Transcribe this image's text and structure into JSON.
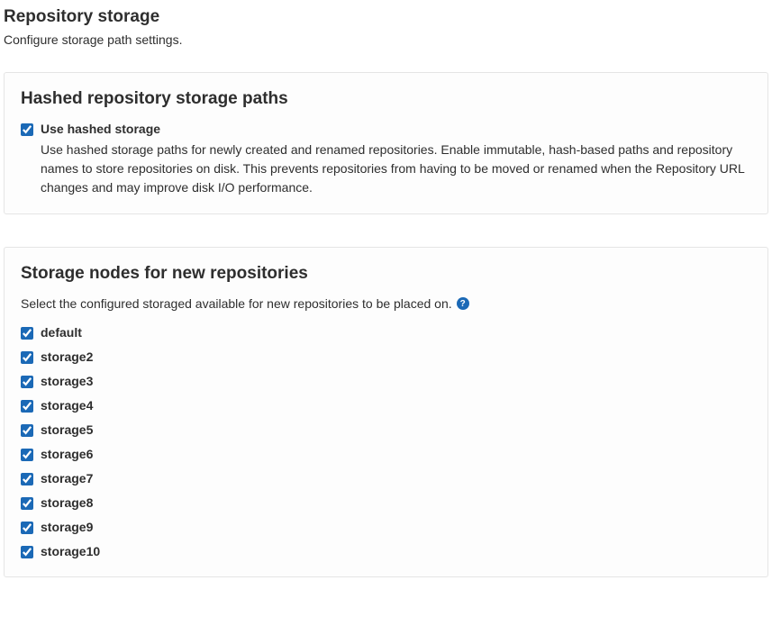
{
  "page": {
    "title": "Repository storage",
    "subtitle": "Configure storage path settings."
  },
  "hashed_panel": {
    "heading": "Hashed repository storage paths",
    "checkbox_label": "Use hashed storage",
    "description": "Use hashed storage paths for newly created and renamed repositories. Enable immutable, hash-based paths and repository names to store repositories on disk. This prevents repositories from having to be moved or renamed when the Repository URL changes and may improve disk I/O performance."
  },
  "nodes_panel": {
    "heading": "Storage nodes for new repositories",
    "subtext": "Select the configured storaged available for new repositories to be placed on.",
    "help_symbol": "?",
    "nodes": [
      {
        "label": "default"
      },
      {
        "label": "storage2"
      },
      {
        "label": "storage3"
      },
      {
        "label": "storage4"
      },
      {
        "label": "storage5"
      },
      {
        "label": "storage6"
      },
      {
        "label": "storage7"
      },
      {
        "label": "storage8"
      },
      {
        "label": "storage9"
      },
      {
        "label": "storage10"
      }
    ]
  }
}
